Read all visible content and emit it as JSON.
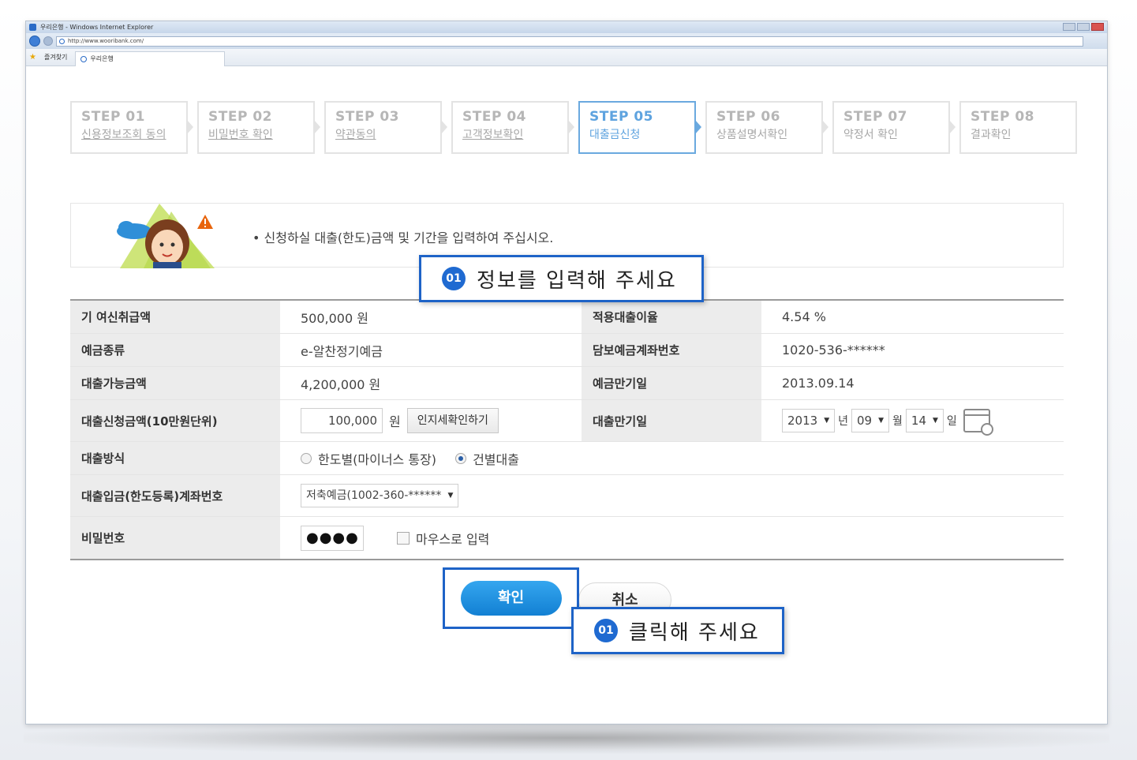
{
  "browser": {
    "title": "우리은행 - Windows Internet Explorer",
    "url": "http://www.wooribank.com/",
    "favorites_label": "즐겨찾기",
    "tab_label": "우리은행"
  },
  "steps": [
    {
      "num": "STEP 01",
      "name": "신용정보조회 동의"
    },
    {
      "num": "STEP 02",
      "name": "비밀번호 확인"
    },
    {
      "num": "STEP 03",
      "name": "약관동의"
    },
    {
      "num": "STEP 04",
      "name": "고객정보확인"
    },
    {
      "num": "STEP 05",
      "name": "대출금신청"
    },
    {
      "num": "STEP 06",
      "name": "상품설명서확인"
    },
    {
      "num": "STEP 07",
      "name": "약정서 확인"
    },
    {
      "num": "STEP 08",
      "name": "결과확인"
    }
  ],
  "notice": {
    "text": "• 신청하실 대출(한도)금액 및 기간을 입력하여 주십시오."
  },
  "callouts": {
    "input": {
      "badge": "01",
      "text": "정보를 입력해 주세요"
    },
    "click": {
      "badge": "01",
      "text": "클릭해 주세요"
    }
  },
  "form": {
    "existing_loan_label": "기 여신취급액",
    "existing_loan_value": "500,000 원",
    "rate_label": "적용대출이율",
    "rate_value": "4.54 %",
    "deposit_type_label": "예금종류",
    "deposit_type_value": "e-알찬정기예금",
    "collateral_account_label": "담보예금계좌번호",
    "collateral_account_value": "1020-536-******",
    "available_label": "대출가능금액",
    "available_value": "4,200,000 원",
    "deposit_maturity_label": "예금만기일",
    "deposit_maturity_value": "2013.09.14",
    "request_amount_label": "대출신청금액(10만원단위)",
    "request_amount_value": "100,000",
    "request_amount_unit": "원",
    "stamp_button": "인지세확인하기",
    "loan_maturity_label": "대출만기일",
    "maturity_year": "2013",
    "year_unit": "년",
    "maturity_month": "09",
    "month_unit": "월",
    "maturity_day": "14",
    "day_unit": "일",
    "method_label": "대출방식",
    "method_option1": "한도별(마이너스 통장)",
    "method_option2": "건별대출",
    "deposit_account_label": "대출입금(한도등록)계좌번호",
    "deposit_account_value": "저축예금(1002-360-******",
    "password_label": "비밀번호",
    "password_value": "●●●●",
    "mouse_input_label": "마우스로 입력"
  },
  "buttons": {
    "confirm": "확인",
    "cancel": "취소"
  },
  "colors": {
    "accent": "#1e63c7",
    "step_active": "#5ea3df",
    "confirm_button": "#1a8ce0"
  }
}
